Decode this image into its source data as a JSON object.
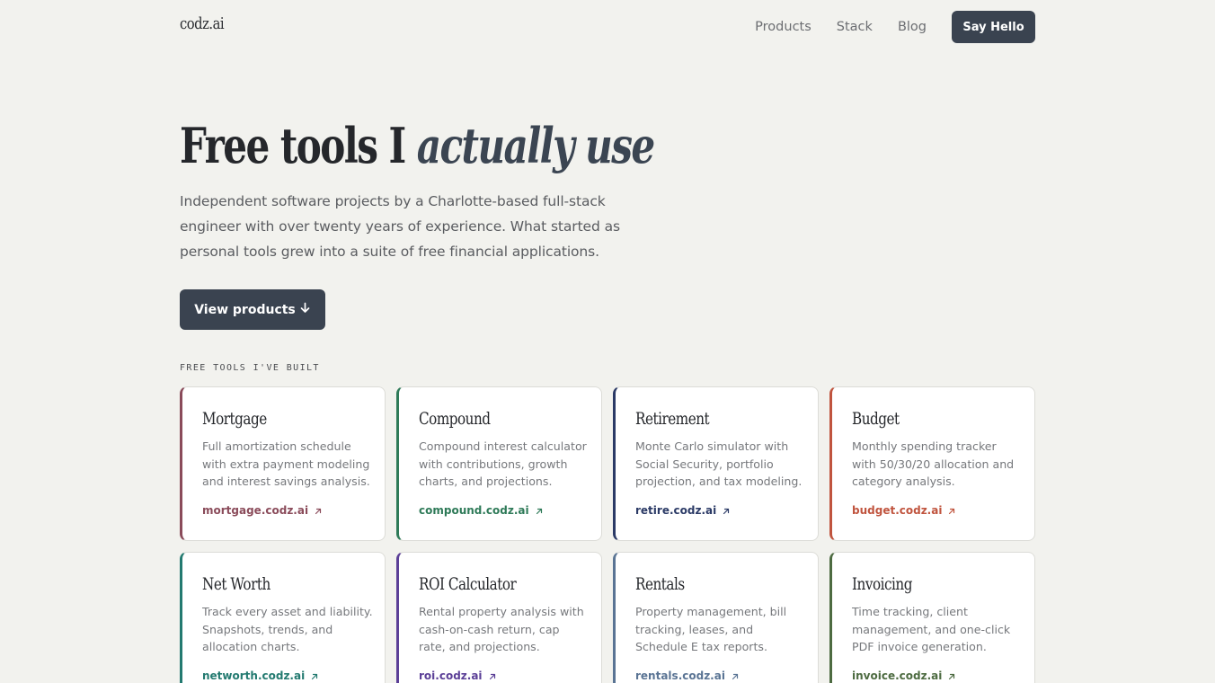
{
  "header": {
    "logo": "codz.ai",
    "nav": [
      {
        "label": "Products"
      },
      {
        "label": "Stack"
      },
      {
        "label": "Blog"
      }
    ],
    "cta_label": "Say Hello"
  },
  "hero": {
    "title_plain": "Free tools I ",
    "title_accent": "actually use",
    "subtitle": "Independent software projects by a Charlotte-based full-stack engineer with over twenty years of experience. What started as personal tools grew into a suite of free financial applications.",
    "button_label": "View products",
    "button_icon": "arrow-down-icon"
  },
  "section_label": "FREE TOOLS I'VE BUILT",
  "products": [
    {
      "title": "Mortgage",
      "description": "Full amortization schedule with extra payment modeling and interest savings analysis.",
      "link": "mortgage.codz.ai",
      "accent": "#8a4b5a"
    },
    {
      "title": "Compound",
      "description": "Compound interest calculator with contributions, growth charts, and projections.",
      "link": "compound.codz.ai",
      "accent": "#2e7a58"
    },
    {
      "title": "Retirement",
      "description": "Monte Carlo simulator with Social Security, portfolio projection, and tax modeling.",
      "link": "retire.codz.ai",
      "accent": "#2b3a66"
    },
    {
      "title": "Budget",
      "description": "Monthly spending tracker with 50/30/20 allocation and category analysis.",
      "link": "budget.codz.ai",
      "accent": "#c0543e"
    },
    {
      "title": "Net Worth",
      "description": "Track every asset and liability. Snapshots, trends, and allocation charts.",
      "link": "networth.codz.ai",
      "accent": "#237a70"
    },
    {
      "title": "ROI Calculator",
      "description": "Rental property analysis with cash-on-cash return, cap rate, and projections.",
      "link": "roi.codz.ai",
      "accent": "#5b3f97"
    },
    {
      "title": "Rentals",
      "description": "Property management, bill tracking, leases, and Schedule E tax reports.",
      "link": "rentals.codz.ai",
      "accent": "#5a7494"
    },
    {
      "title": "Invoicing",
      "description": "Time tracking, client management, and one-click PDF invoice generation.",
      "link": "invoice.codz.ai",
      "accent": "#4d6b41"
    }
  ]
}
